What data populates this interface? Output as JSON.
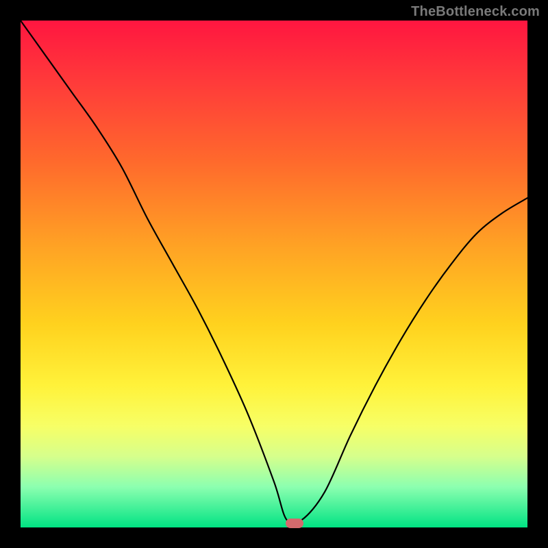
{
  "watermark": "TheBottleneck.com",
  "marker": {
    "x_frac": 0.54,
    "y_frac": 0.992
  },
  "chart_data": {
    "type": "line",
    "title": "",
    "xlabel": "",
    "ylabel": "",
    "xlim": [
      0,
      1
    ],
    "ylim": [
      0,
      1
    ],
    "series": [
      {
        "name": "bottleneck-curve",
        "x": [
          0.0,
          0.05,
          0.1,
          0.15,
          0.2,
          0.25,
          0.3,
          0.35,
          0.4,
          0.45,
          0.5,
          0.525,
          0.555,
          0.6,
          0.65,
          0.7,
          0.75,
          0.8,
          0.85,
          0.9,
          0.95,
          1.0
        ],
        "y": [
          1.0,
          0.93,
          0.86,
          0.79,
          0.71,
          0.61,
          0.52,
          0.43,
          0.33,
          0.22,
          0.09,
          0.015,
          0.015,
          0.07,
          0.18,
          0.28,
          0.37,
          0.45,
          0.52,
          0.58,
          0.62,
          0.65
        ]
      }
    ],
    "annotations": [
      {
        "type": "marker",
        "x": 0.54,
        "y": 0.008,
        "label": "optimal-point"
      }
    ],
    "background_gradient": {
      "top": "#ff1640",
      "mid": "#ffd21e",
      "bottom": "#00e383"
    }
  }
}
